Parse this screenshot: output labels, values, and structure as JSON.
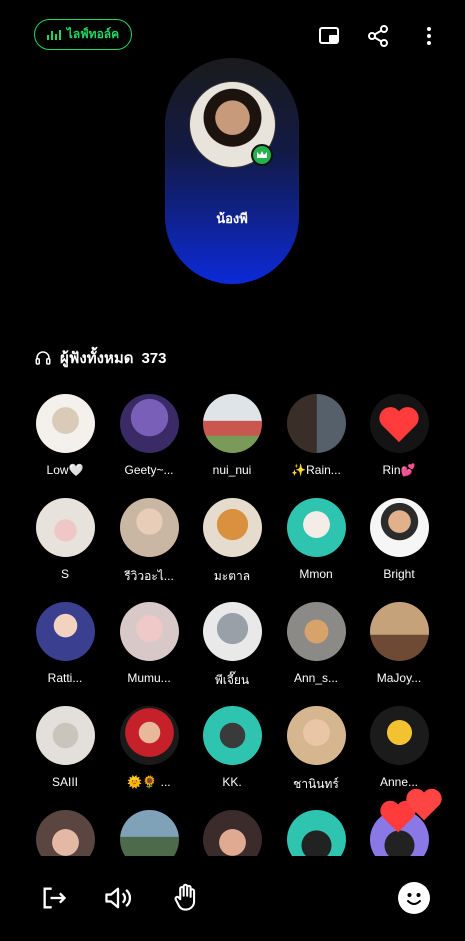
{
  "header": {
    "live_label": "ไลฟ์ทอล์ค",
    "icons": [
      "minimize-icon",
      "share-icon",
      "more-vertical-icon"
    ]
  },
  "host": {
    "name": "น้องพี",
    "badge": "crown-icon"
  },
  "listeners": {
    "label": "ผู้ฟังทั้งหมด",
    "count": "373",
    "items": [
      {
        "name": "Low🤍"
      },
      {
        "name": "Geety~..."
      },
      {
        "name": "nui_nui"
      },
      {
        "name": "✨Rain..."
      },
      {
        "name": "Rin💕"
      },
      {
        "name": "S"
      },
      {
        "name": "รีวิวอะไ..."
      },
      {
        "name": "มะตาล"
      },
      {
        "name": "Mmon"
      },
      {
        "name": "Bright"
      },
      {
        "name": "Ratti..."
      },
      {
        "name": "Mumu..."
      },
      {
        "name": "พีเจี๊ยน"
      },
      {
        "name": "Ann_s..."
      },
      {
        "name": "MaJoy..."
      },
      {
        "name": "SAIII"
      },
      {
        "name": "🌞🌻 ..."
      },
      {
        "name": "KK."
      },
      {
        "name": "ชานินทร์"
      },
      {
        "name": "Anne..."
      },
      {
        "name": ""
      },
      {
        "name": ""
      },
      {
        "name": ""
      },
      {
        "name": ""
      },
      {
        "name": ""
      }
    ]
  },
  "bottom_bar": {
    "icons": [
      "leave-icon",
      "speaker-icon",
      "raise-hand-icon",
      "emoji-icon"
    ]
  },
  "colors": {
    "accent_green": "#1ed760",
    "host_gradient_bottom": "#0c2ad8",
    "heart": "#ff3b3b"
  }
}
